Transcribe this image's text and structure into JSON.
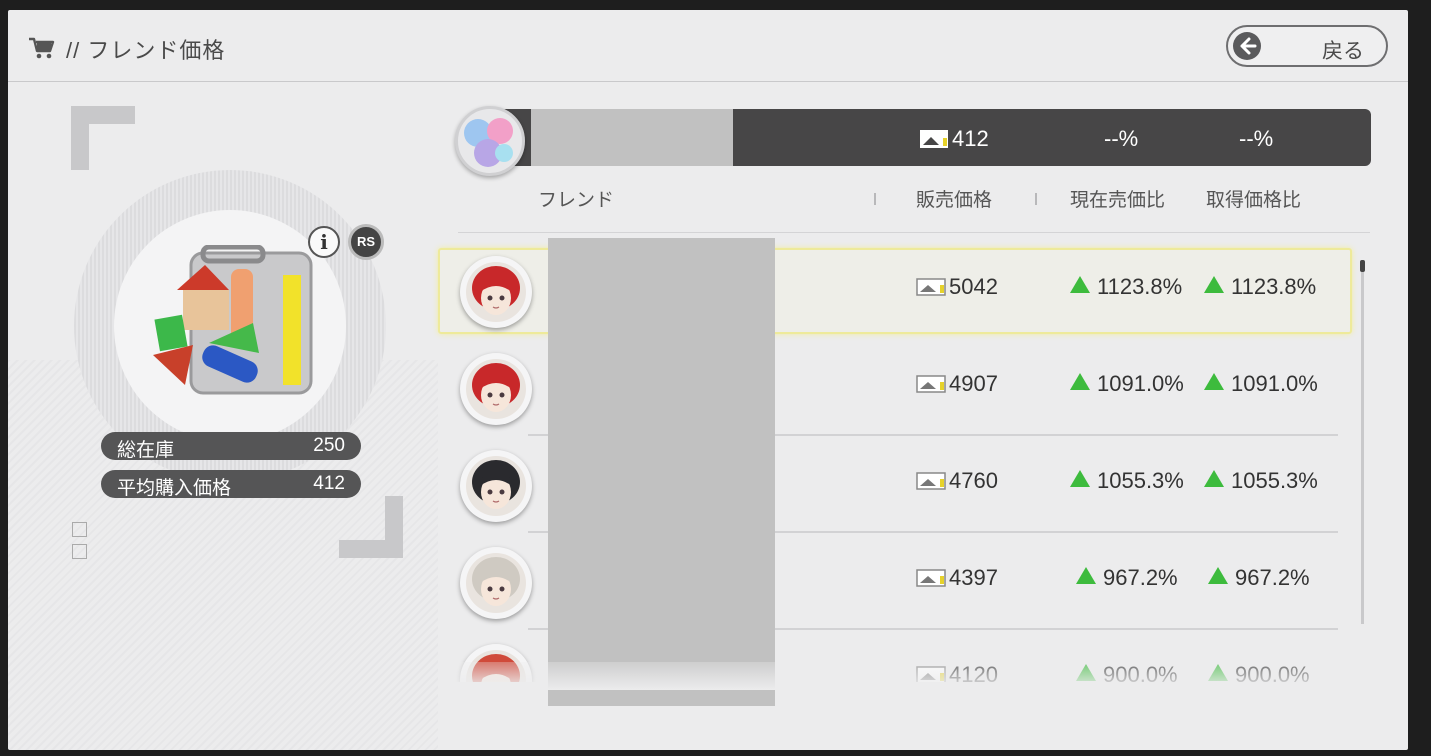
{
  "header": {
    "title": "// フレンド価格",
    "back_label": "戻る"
  },
  "item": {
    "stats": [
      {
        "label": "総在庫",
        "value": "250"
      },
      {
        "label": "平均購入価格",
        "value": "412"
      }
    ],
    "rs_label": "RS",
    "info_label": "i"
  },
  "summary": {
    "price": "412",
    "current_ratio": "--%",
    "acquired_ratio": "--%"
  },
  "columns": {
    "friend": "フレンド",
    "price": "販売価格",
    "current": "現在売価比",
    "acquired": "取得価格比"
  },
  "rows": [
    {
      "price": "5042",
      "current": "1123.8%",
      "acquired": "1123.8%",
      "selected": true,
      "hair": "#c8282a"
    },
    {
      "price": "4907",
      "current": "1091.0%",
      "acquired": "1091.0%",
      "selected": false,
      "hair": "#c8282a"
    },
    {
      "price": "4760",
      "current": "1055.3%",
      "acquired": "1055.3%",
      "selected": false,
      "hair": "#2a2a2e"
    },
    {
      "price": "4397",
      "current": "967.2%",
      "acquired": "967.2%",
      "selected": false,
      "hair": "#cfcac2"
    },
    {
      "price": "4120",
      "current": "900.0%",
      "acquired": "900.0%",
      "selected": false,
      "hair": "#d04a3a"
    }
  ],
  "colors": {
    "accent_up": "#3dbb3d",
    "selection": "#eeea9a",
    "bar": "#474647"
  }
}
